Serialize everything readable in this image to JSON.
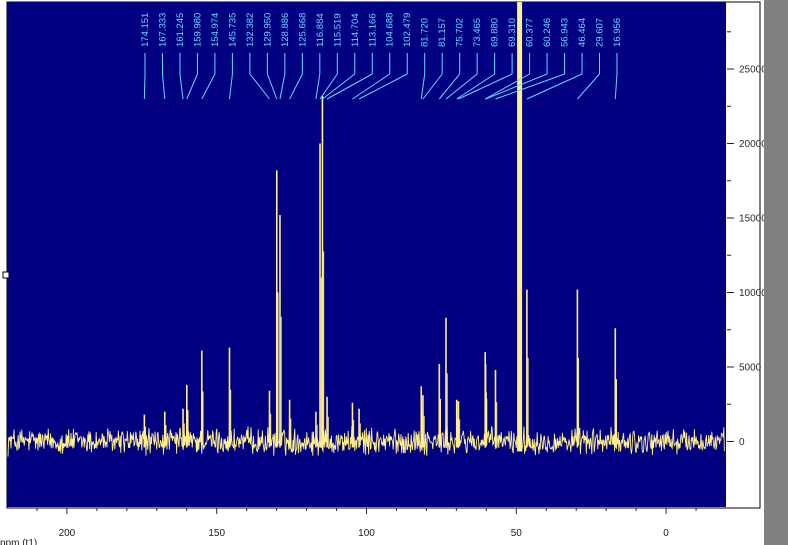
{
  "colors": {
    "plot_bg": "#000080",
    "spectrum": "#fff08a",
    "label": "#66d8ff",
    "frame_bg": "#ffffff",
    "outer_bg": "#808080"
  },
  "chart_data": {
    "type": "line",
    "title": "",
    "xlabel": "ppm (t1)",
    "ylabel": "",
    "xlim": [
      220,
      -20
    ],
    "ylim": [
      -4400,
      29500
    ],
    "x_ticks": [
      "200",
      "150",
      "100",
      "50",
      "0"
    ],
    "x_tick_values": [
      200,
      150,
      100,
      50,
      0
    ],
    "y_ticks": [
      "25000",
      "20000",
      "15000",
      "10000",
      "5000",
      "0"
    ],
    "y_tick_values": [
      25000,
      20000,
      15000,
      10000,
      5000,
      0
    ],
    "grid": false,
    "noise_level": 700,
    "peak_labels": [
      "174.151",
      "167.333",
      "161.245",
      "159.980",
      "154.974",
      "145.735",
      "132.382",
      "129.950",
      "128.886",
      "125.668",
      "116.884",
      "115.519",
      "114.704",
      "113.166",
      "104.688",
      "102.479",
      "81.720",
      "81.157",
      "75.702",
      "73.465",
      "69.880",
      "69.310",
      "60.377",
      "60.246",
      "56.943",
      "46.464",
      "29.607",
      "16.956"
    ],
    "peaks": [
      {
        "ppm": 174.151,
        "intensity": 1800
      },
      {
        "ppm": 167.333,
        "intensity": 2000
      },
      {
        "ppm": 161.245,
        "intensity": 2200
      },
      {
        "ppm": 159.98,
        "intensity": 3800
      },
      {
        "ppm": 154.974,
        "intensity": 6100
      },
      {
        "ppm": 145.735,
        "intensity": 6300
      },
      {
        "ppm": 132.382,
        "intensity": 3400
      },
      {
        "ppm": 129.95,
        "intensity": 18200
      },
      {
        "ppm": 128.886,
        "intensity": 15200
      },
      {
        "ppm": 125.668,
        "intensity": 2800
      },
      {
        "ppm": 116.884,
        "intensity": 2000
      },
      {
        "ppm": 115.519,
        "intensity": 20000
      },
      {
        "ppm": 114.704,
        "intensity": 23200
      },
      {
        "ppm": 113.166,
        "intensity": 3000
      },
      {
        "ppm": 104.688,
        "intensity": 2600
      },
      {
        "ppm": 102.479,
        "intensity": 2200
      },
      {
        "ppm": 81.72,
        "intensity": 3700
      },
      {
        "ppm": 81.157,
        "intensity": 3100
      },
      {
        "ppm": 75.702,
        "intensity": 5200
      },
      {
        "ppm": 73.465,
        "intensity": 8300
      },
      {
        "ppm": 69.88,
        "intensity": 2800
      },
      {
        "ppm": 69.31,
        "intensity": 2700
      },
      {
        "ppm": 60.377,
        "intensity": 6000
      },
      {
        "ppm": 60.246,
        "intensity": 5200
      },
      {
        "ppm": 56.943,
        "intensity": 4800
      },
      {
        "ppm": 46.464,
        "intensity": 10200
      },
      {
        "ppm": 29.607,
        "intensity": 10200
      },
      {
        "ppm": 16.956,
        "intensity": 7600
      }
    ],
    "solvent_peak": {
      "ppm": 48.9,
      "intensity": 30000
    }
  }
}
